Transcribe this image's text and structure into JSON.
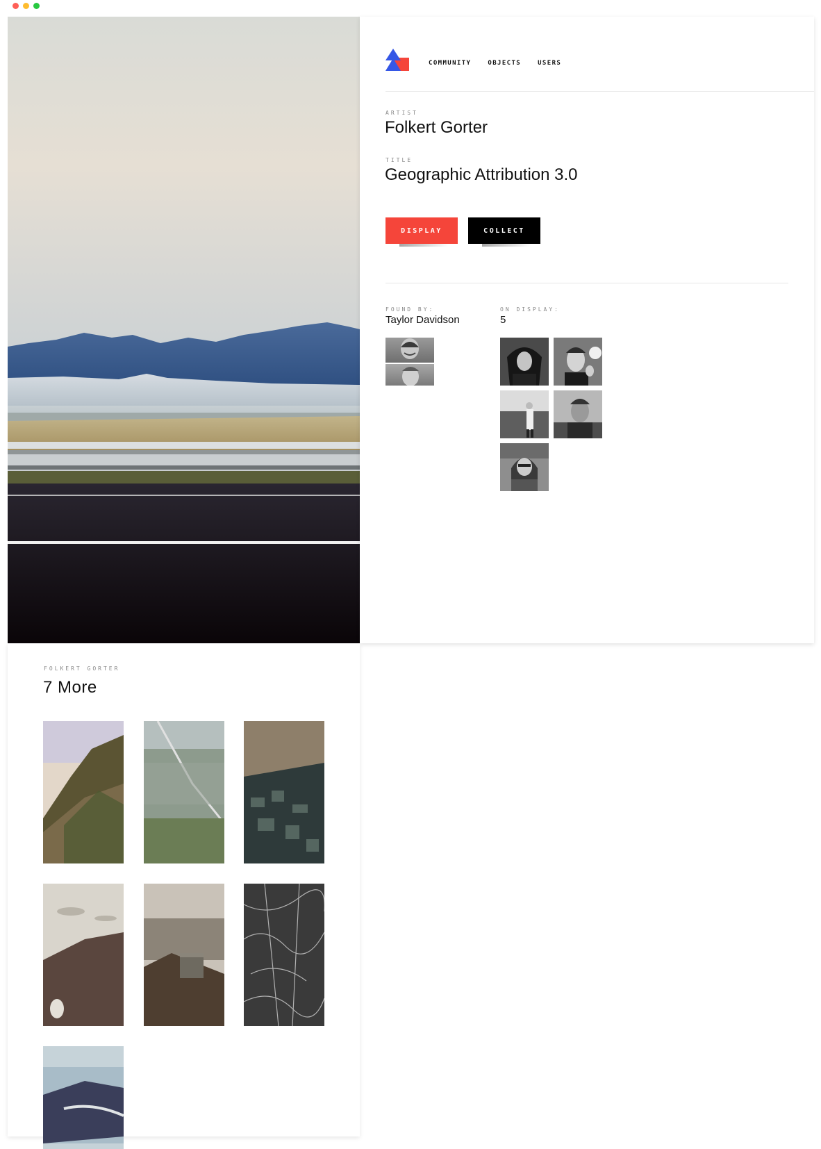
{
  "nav": {
    "items": [
      "COMMUNITY",
      "OBJECTS",
      "USERS"
    ],
    "logo_colors": {
      "blue": "#3557e6",
      "red": "#f5453a"
    }
  },
  "artwork": {
    "artist_label": "ARTIST",
    "artist": "Folkert Gorter",
    "title_label": "TITLE",
    "title": "Geographic Attribution 3.0"
  },
  "actions": {
    "display_label": "DISPLAY",
    "collect_label": "COLLECT",
    "display_color": "#f5453a",
    "collect_color": "#000000"
  },
  "found_by": {
    "label": "FOUND BY:",
    "name": "Taylor Davidson"
  },
  "on_display": {
    "label": "ON DISPLAY:",
    "count": "5"
  },
  "more": {
    "label": "FOLKERT GORTER",
    "title": "7  More"
  }
}
